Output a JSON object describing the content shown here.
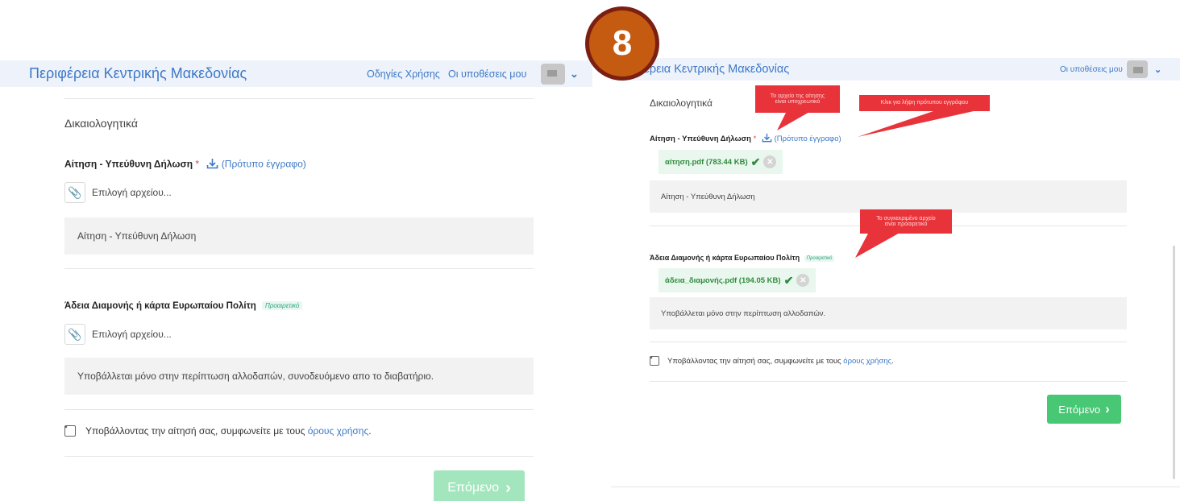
{
  "step_number": "8",
  "left": {
    "header": {
      "title": "Περιφέρεια Κεντρικής Μακεδονίας",
      "nav": [
        "Οδηγίες Χρήσης",
        "Οι υποθέσεις μου"
      ]
    },
    "section_title": "Δικαιολογητικά",
    "field1": {
      "label": "Αίτηση - Υπεύθυνη Δήλωση",
      "required_mark": "*",
      "template_link": "(Πρότυπο έγγραφο)",
      "file_button": "Επιλογή αρχείου...",
      "hint": "Αίτηση - Υπεύθυνη Δήλωση"
    },
    "field2": {
      "label": "Άδεια Διαμονής ή κάρτα Ευρωπαίου Πολίτη",
      "optional_badge": "Προαιρετικό",
      "file_button": "Επιλογή αρχείου...",
      "hint": "Υποβάλλεται μόνο στην περίπτωση αλλοδαπών, συνοδευόμενο απο το διαβατήριο."
    },
    "terms": {
      "text": "Υποβάλλοντας την αίτησή σας, συμφωνείτε με τους",
      "link": "όρους χρήσης",
      "end": "."
    },
    "next_button": "Επόμενο",
    "next_chevron": "›"
  },
  "right": {
    "header": {
      "title": "φέρεια Κεντρικής Μακεδονίας",
      "nav": [
        "Οι υποθέσεις μου"
      ]
    },
    "section_title": "Δικαιολογητικά",
    "field1": {
      "label": "Αίτηση - Υπεύθυνη Δήλωση",
      "required_mark": "*",
      "template_link": "(Πρότυπο έγγραφο)",
      "uploaded_file": "αίτηση.pdf (783.44 KB)",
      "hint": "Αίτηση - Υπεύθυνη Δήλωση"
    },
    "field2": {
      "label": "Άδεια Διαμονής ή κάρτα Ευρωπαίου Πολίτη",
      "optional_badge": "Προαιρετικό",
      "uploaded_file": "άδεια_διαμονής.pdf (194.05 KB)",
      "hint": "Υποβάλλεται μόνο στην περίπτωση αλλοδαπών."
    },
    "terms": {
      "text": "Υποβάλλοντας την αίτησή σας, συμφωνείτε με τους",
      "link": "όρους χρήσης",
      "end": "."
    },
    "next_button": "Επόμενο",
    "next_chevron": "›",
    "callouts": {
      "required_note": [
        "Το αρχείο της αίτησης",
        "είναι υποχρεωτικό"
      ],
      "template_note": [
        "Κλικ για λήψη πρότυπου εγγράφου"
      ],
      "optional_note": [
        "Το συγκεκριμένο αρχείο",
        "είναι προαιρετικό"
      ]
    }
  },
  "colors": {
    "brand_blue": "#3d78c7",
    "next_green_active": "#48c774",
    "next_green_disabled": "#a3e6bd",
    "callout_red": "#e8333a",
    "badge_orange": "#c55a11"
  }
}
